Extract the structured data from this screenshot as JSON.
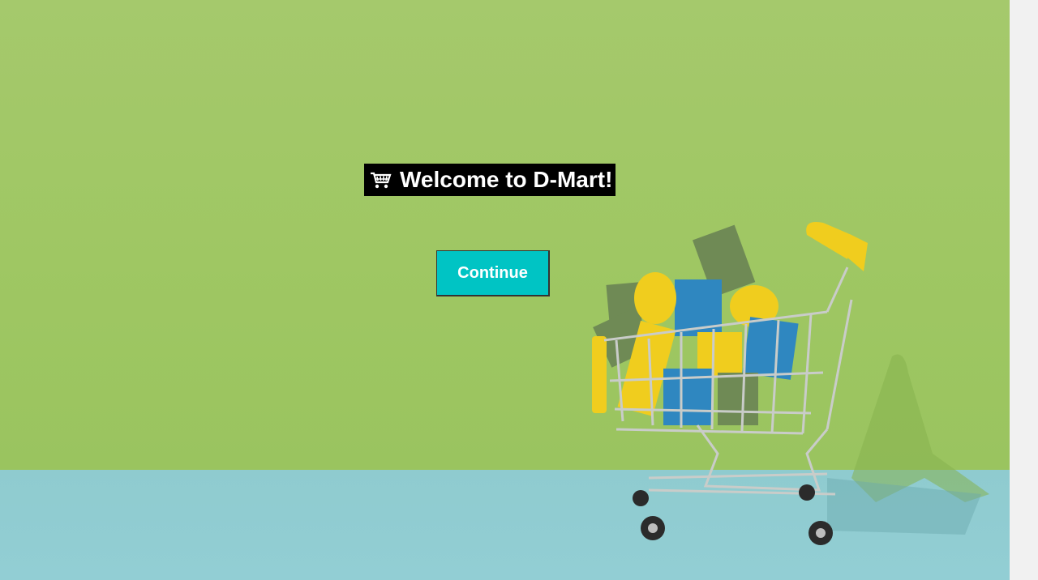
{
  "welcome": {
    "icon": "shopping-cart-icon",
    "text": "Welcome to D-Mart!"
  },
  "actions": {
    "continue_label": "Continue"
  },
  "colors": {
    "wall": "#a2c866",
    "floor": "#90ccd1",
    "button": "#00c4c4",
    "banner": "#000000"
  }
}
